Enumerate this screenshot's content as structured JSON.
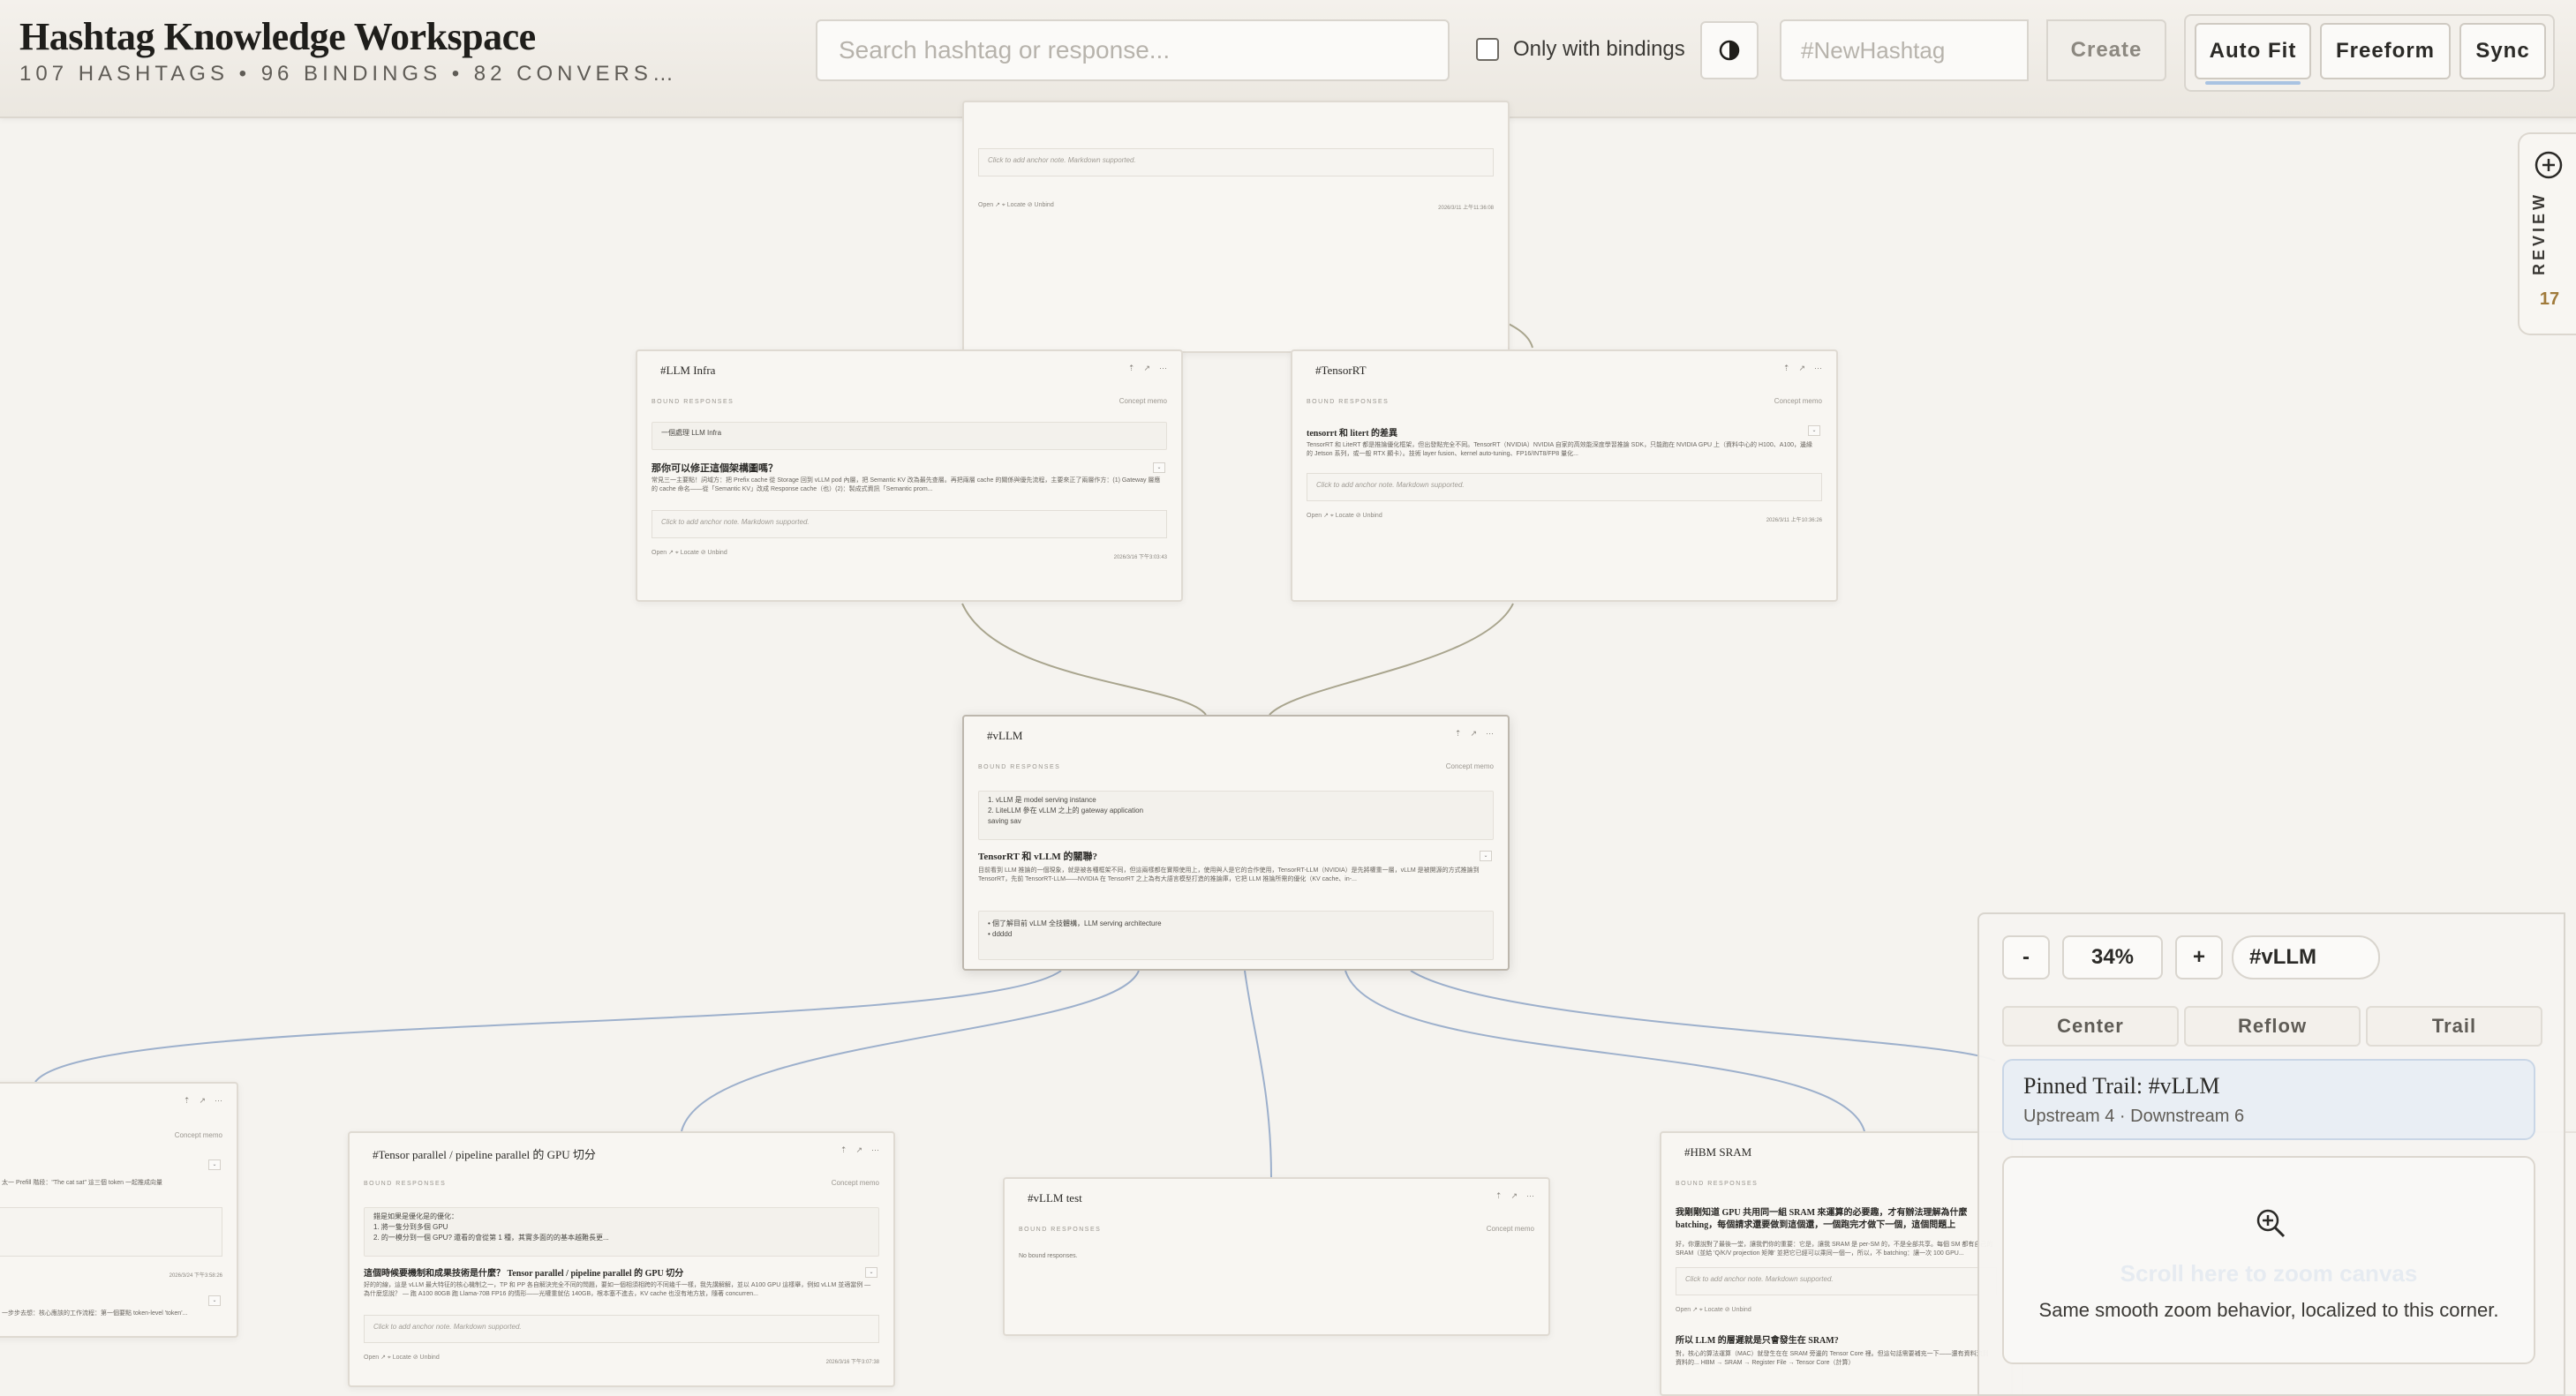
{
  "header": {
    "title": "Hashtag Knowledge Workspace",
    "subtitle": "107 HASHTAGS • 96 BINDINGS • 82 CONVERS…",
    "search_placeholder": "Search hashtag or response...",
    "only_bindings_label": "Only with bindings",
    "new_hashtag_placeholder": "#NewHashtag",
    "create_label": "Create",
    "modes": {
      "auto_fit": "Auto Fit",
      "freeform": "Freeform",
      "sync": "Sync"
    },
    "active_mode": "auto_fit"
  },
  "review": {
    "label": "REVIEW",
    "count": "17"
  },
  "common": {
    "bound_label": "BOUND RESPONSES",
    "memo_label": "Concept memo",
    "note_placeholder": "Click to add anchor note. Markdown supported.",
    "foot": "Open ↗  ⌖ Locate  ⊘ Unbind"
  },
  "cards": {
    "top": {
      "foot_time": "2026/3/11 上午11:36:08"
    },
    "llm_infra": {
      "title": "#LLM Infra",
      "intro": "一個處理 LLM Infra",
      "question": "那你可以修正這個架構圖嗎？",
      "answer": "常見三一主要點！詞域方：把 Prefix cache 從 Storage 回到 vLLM pod 內層，把 Semantic KV 改為最先查層。再把兩層 cache 的關係與優先流程，主要來正了兩層作方：(1) Gateway 層應的 cache 命名——從「Semantic KV」改成 Response cache（也）(2)：製成式資訊「Semantic prom...",
      "foot_time": "2026/3/16 下午3:03:43"
    },
    "tensorrt": {
      "title": "#TensorRT",
      "question": "tensorrt 和 litert 的差異",
      "answer": "TensorRT 和 LiteRT 都是推論優化框架，但出發點完全不同。TensorRT（NVIDIA）NVIDIA 自家的高效能深度學習推論 SDK，只能跑在 NVIDIA GPU 上（資料中心的 H100、A100，邊緣的 Jetson 系列，或一般 RTX 顯卡）。技術 layer fusion、kernel auto-tuning、FP16/INT8/FP8 量化...",
      "foot_time": "2026/3/11 上午10:36:26"
    },
    "vllm": {
      "title": "#vLLM",
      "intro_lines": [
        "1. vLLM 是 model serving instance",
        "2. LiteLLM 參在 vLLM 之上的 gateway application",
        "saving sav"
      ],
      "question": "TensorRT 和 vLLM 的關聯?",
      "answer": "目前看到 LLM 推論的一個現象，就是被各種框架不同，但這兩樣都在實際使用上，使用與人是它的合作使用，TensorRT-LLM（NVIDIA）是先將權重一層，vLLM 是被開源的方式推論到 TensorRT，先前 TensorRT-LLM——NVIDIA 在 TensorRT 之上為有大語言模型打造的推論庫，它把 LLM 推論所需的優化（KV cache、in-...",
      "bullets": [
        "• 個了解目前 vLLM 全技體構，LLM serving architecture",
        "• ddddd"
      ]
    },
    "tp": {
      "title": "#Tensor parallel / pipeline parallel 的 GPU 切分",
      "intro_lines": [
        "錯是如果是優化是的優化：",
        "1. 將一隻分到多個 GPU",
        "2. 的一模分到一個 GPU? 還看的會從第 1 種，其實多面的的基本越難長更..."
      ],
      "question": "這個時候要機制和成果技術是什麼？ Tensor parallel / pipeline parallel 的 GPU 切分",
      "answer": "好的的線，這是 vLLM 最大特征的核心機制之一，TP 和 PP 各自解決完全不同的問題，要如一個相須相跨的不同幾千一樣，我先講解解，並以 A100 GPU 這樣舉，例如 vLLM 並適當例 — 為什麼您說？ — 跑 A100 80GB 跑 Llama-70B FP16 的情形——光權重就佔 140GB，根本塞不進去，KV cache 也沒有地方放，隨著 concurren...",
      "foot_time": "2026/3/16 下午3:07:38"
    },
    "vllm_test": {
      "title": "#vLLM test",
      "empty": "No bound responses."
    },
    "hbm": {
      "title": "#HBM SRAM",
      "question": "我剛剛知道 GPU 共用同一組 SRAM 來運算的必要趣，才有辦法理解為什麼 batching，每個請求還要做到這個還，一個跑完才做下一個，這個問題上",
      "answer": "好，你還說對了最後一堂，讓我們你的重要：它是，讓我 SRAM 是 per-SM 的，不是全部共享。每個 SM 都有自己的 SRAM（並給 'Q/K/V projection 矩陣' 並把它已經可以乘同一個一，所以，不 batching：讓一次 100 GPU...",
      "question2": "所以 LLM 的層遲就是只會發生在 SRAM?",
      "answer2": "對，核心的算法運算（MAC）就發生在在 SRAM 旁邊的 Tensor Core 裡。但這句話需要補充一下——還有資料流到資料的...  HBM → SRAM → Register File → Tensor Core（計算）"
    },
    "left": {
      "answer": "太一 Prefill 階段：\"The cat sat\" 這三個 token 一起推成向量",
      "answer2": "一步步去想：核心應該的工作流程：第一個要點 token-level 'token'...",
      "foot_time": "2026/3/24 下午3:58:26"
    }
  },
  "zoom": {
    "minus": "-",
    "level": "34%",
    "plus": "+",
    "focus": "#vLLM",
    "center": "Center",
    "reflow": "Reflow",
    "trail": "Trail",
    "trail_title": "Pinned Trail: #vLLM",
    "trail_sub": "Upstream 4 · Downstream 6",
    "zone_title": "Scroll here to zoom canvas",
    "zone_sub": "Same smooth zoom behavior, localized to this corner."
  },
  "colors": {
    "edge_upstream": "#a9a58e",
    "edge_downstream": "#9db0cc",
    "trail_bg": "#e9eef4"
  }
}
